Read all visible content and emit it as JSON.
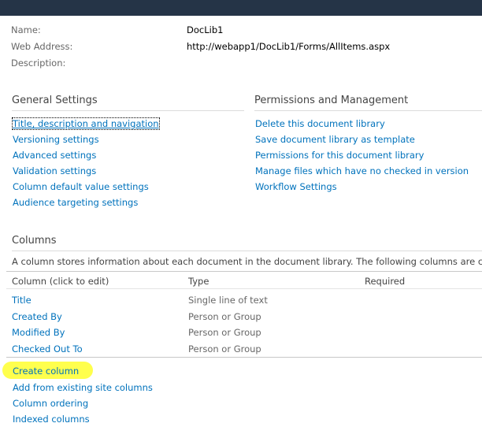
{
  "info": {
    "name_label": "Name:",
    "name_value": "DocLib1",
    "web_address_label": "Web Address:",
    "web_address_value": "http://webapp1/DocLib1/Forms/AllItems.aspx",
    "description_label": "Description:"
  },
  "general_settings": {
    "heading": "General Settings",
    "links": [
      "Title, description and navigation",
      "Versioning settings",
      "Advanced settings",
      "Validation settings",
      "Column default value settings",
      "Audience targeting settings"
    ]
  },
  "permissions": {
    "heading": "Permissions and Management",
    "links": [
      "Delete this document library",
      "Save document library as template",
      "Permissions for this document library",
      "Manage files which have no checked in version",
      "Workflow Settings"
    ]
  },
  "columns": {
    "heading": "Columns",
    "description": "A column stores information about each document in the document library. The following columns are cu",
    "headers": [
      "Column (click to edit)",
      "Type",
      "Required"
    ],
    "rows": [
      {
        "name": "Title",
        "type": "Single line of text"
      },
      {
        "name": "Created By",
        "type": "Person or Group"
      },
      {
        "name": "Modified By",
        "type": "Person or Group"
      },
      {
        "name": "Checked Out To",
        "type": "Person or Group"
      }
    ],
    "actions": [
      "Create column",
      "Add from existing site columns",
      "Column ordering",
      "Indexed columns"
    ]
  },
  "colors": {
    "link": "#0072bc",
    "topbar": "#253447",
    "highlight": "#ffff3a"
  }
}
